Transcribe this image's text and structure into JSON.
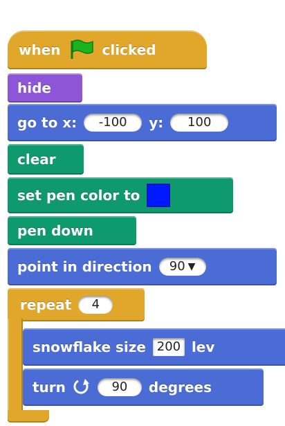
{
  "script": {
    "hat": {
      "before": "when",
      "icon": "green-flag-icon",
      "after": "clicked"
    },
    "hide": {
      "label": "hide"
    },
    "goto": {
      "label": "go to x:",
      "x_value": "-100",
      "y_label": "y:",
      "y_value": "100"
    },
    "clear": {
      "label": "clear"
    },
    "set_pen_color": {
      "label": "set pen color to",
      "color": "#0019ff"
    },
    "pen_down": {
      "label": "pen down"
    },
    "point": {
      "label": "point in direction",
      "value": "90"
    },
    "repeat": {
      "label": "repeat",
      "value": "4"
    },
    "snowflake": {
      "label": "snowflake size",
      "size_value": "200",
      "suffix": "lev"
    },
    "turn": {
      "label": "turn",
      "icon": "rotate-clockwise-icon",
      "value": "90",
      "suffix": "degrees"
    }
  },
  "colors": {
    "control": "#e0a72b",
    "looks": "#8e55d6",
    "motion": "#4a6cd4",
    "pen": "#0e9a6c",
    "flag": "#19b41d"
  }
}
